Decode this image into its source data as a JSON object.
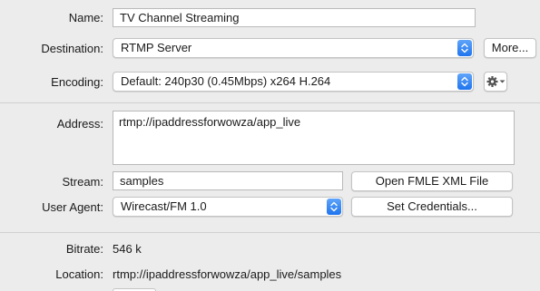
{
  "name": {
    "label": "Name:",
    "value": "TV Channel Streaming"
  },
  "destination": {
    "label": "Destination:",
    "value": "RTMP Server",
    "more_label": "More..."
  },
  "encoding": {
    "label": "Encoding:",
    "value": "Default: 240p30 (0.45Mbps) x264 H.264"
  },
  "address": {
    "label": "Address:",
    "value": "rtmp://ipaddressforwowza/app_live"
  },
  "stream": {
    "label": "Stream:",
    "value": "samples",
    "open_fmle_label": "Open FMLE XML File"
  },
  "user_agent": {
    "label": "User Agent:",
    "value": "Wirecast/FM 1.0",
    "credentials_label": "Set Credentials..."
  },
  "bitrate": {
    "label": "Bitrate:",
    "value": "546 k"
  },
  "location": {
    "label": "Location:",
    "value": "rtmp://ipaddressforwowza/app_live/samples"
  },
  "colors": {
    "background": "#ececec",
    "stepper_blue": "#1f74ee"
  },
  "icons": [
    "stepper-icon",
    "gear-icon",
    "chevron-down-icon"
  ]
}
